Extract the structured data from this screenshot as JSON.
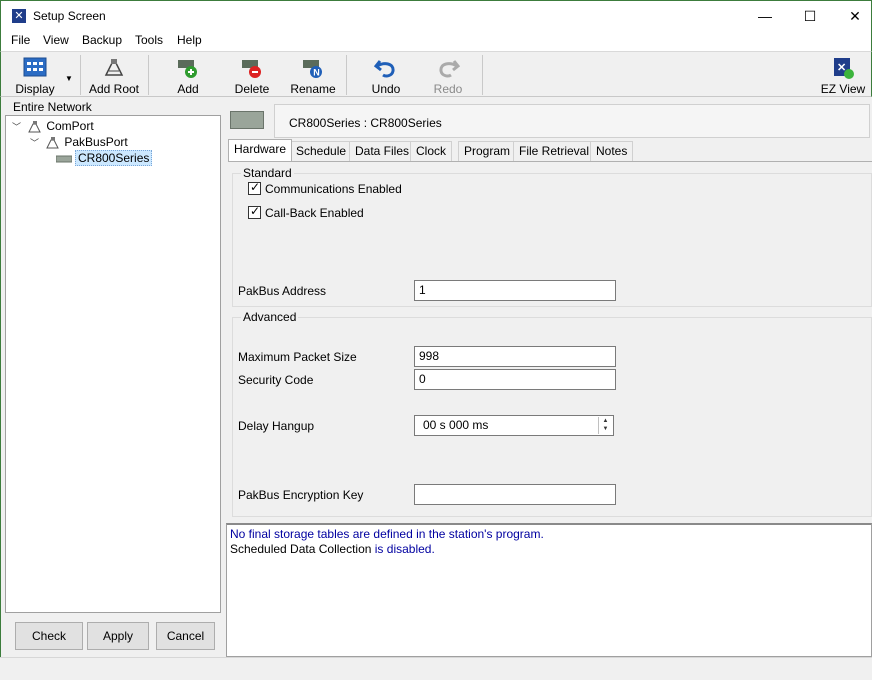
{
  "window": {
    "title": "Setup Screen",
    "minimize": "—",
    "maximize": "☐",
    "close": "✕"
  },
  "menu": [
    "File",
    "View",
    "Backup",
    "Tools",
    "Help"
  ],
  "toolbar": {
    "display": "Display",
    "add_root": "Add Root",
    "add": "Add",
    "delete": "Delete",
    "rename": "Rename",
    "undo": "Undo",
    "redo": "Redo",
    "ez_view": "EZ View"
  },
  "left": {
    "header": "Entire Network",
    "tree": [
      {
        "label": "ComPort",
        "level": 0
      },
      {
        "label": "PakBusPort",
        "level": 1
      },
      {
        "label": "CR800Series",
        "level": 2,
        "selected": true
      }
    ],
    "buttons": {
      "check": "Check",
      "apply": "Apply",
      "cancel": "Cancel"
    }
  },
  "device": {
    "title": "CR800Series : CR800Series"
  },
  "tabs": [
    "Hardware",
    "Schedule",
    "Data Files",
    "Clock",
    "Program",
    "File Retrieval",
    "Notes"
  ],
  "active_tab": "Hardware",
  "hardware": {
    "standard_label": "Standard",
    "comm_enabled_label": "Communications Enabled",
    "comm_enabled": true,
    "callback_label": "Call-Back Enabled",
    "callback_enabled": true,
    "pakbus_address_label": "PakBus Address",
    "pakbus_address": "1",
    "advanced_label": "Advanced",
    "max_packet_label": "Maximum Packet Size",
    "max_packet": "998",
    "security_label": "Security Code",
    "security": "0",
    "delay_label": "Delay Hangup",
    "delay": "00 s 000 ms",
    "encryption_label": "PakBus Encryption Key",
    "encryption": ""
  },
  "messages": {
    "line1": "No final storage tables are defined in the station's program.",
    "line2_a": "Scheduled Data Collection",
    "line2_b": "is disabled."
  },
  "colors": {
    "accent_blue": "#0000a0",
    "selection": "#cce8ff"
  }
}
